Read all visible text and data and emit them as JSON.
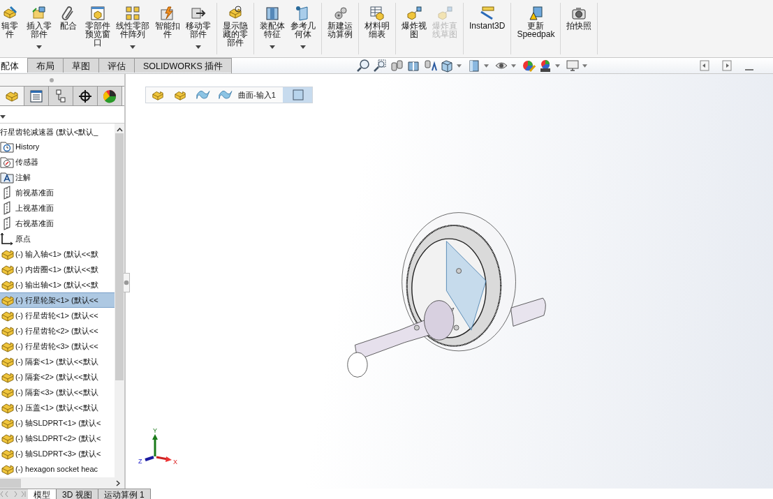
{
  "ribbon": {
    "groups": [
      {
        "buttons": [
          {
            "lines": [
              "辑零",
              "件"
            ],
            "dropdown": false,
            "disabled": false
          },
          {
            "lines": [
              "插入零",
              "部件"
            ],
            "dropdown": true,
            "disabled": false
          },
          {
            "lines": [
              "配合"
            ],
            "dropdown": false,
            "disabled": false
          },
          {
            "lines": [
              "零部件",
              "预览窗",
              "口"
            ],
            "dropdown": false,
            "disabled": false
          },
          {
            "lines": [
              "线性零部",
              "件阵列"
            ],
            "dropdown": true,
            "disabled": false
          },
          {
            "lines": [
              "智能扣",
              "件"
            ],
            "dropdown": false,
            "disabled": false
          },
          {
            "lines": [
              "移动零",
              "部件"
            ],
            "dropdown": true,
            "disabled": false
          }
        ]
      },
      {
        "buttons": [
          {
            "lines": [
              "显示隐",
              "藏的零",
              "部件"
            ],
            "dropdown": false,
            "disabled": false
          }
        ]
      },
      {
        "buttons": [
          {
            "lines": [
              "装配体",
              "特征"
            ],
            "dropdown": true,
            "disabled": false
          },
          {
            "lines": [
              "参考几",
              "何体"
            ],
            "dropdown": true,
            "disabled": false
          }
        ]
      },
      {
        "buttons": [
          {
            "lines": [
              "新建运",
              "动算例"
            ],
            "dropdown": false,
            "disabled": false
          }
        ]
      },
      {
        "buttons": [
          {
            "lines": [
              "材料明",
              "细表"
            ],
            "dropdown": false,
            "disabled": false
          }
        ]
      },
      {
        "buttons": [
          {
            "lines": [
              "爆炸视",
              "图"
            ],
            "dropdown": false,
            "disabled": false
          },
          {
            "lines": [
              "爆炸直",
              "线草图"
            ],
            "dropdown": false,
            "disabled": true
          }
        ]
      },
      {
        "buttons": [
          {
            "lines": [
              "Instant3D"
            ],
            "dropdown": false,
            "disabled": false
          }
        ]
      },
      {
        "buttons": [
          {
            "lines": [
              "更新",
              "Speedpak"
            ],
            "dropdown": false,
            "disabled": false
          }
        ]
      },
      {
        "buttons": [
          {
            "lines": [
              "拍快照"
            ],
            "dropdown": false,
            "disabled": false
          }
        ]
      }
    ]
  },
  "command_tabs": [
    {
      "label": "配体",
      "selected": true
    },
    {
      "label": "布局",
      "selected": false
    },
    {
      "label": "草图",
      "selected": false
    },
    {
      "label": "评估",
      "selected": false
    },
    {
      "label": "SOLIDWORKS 插件",
      "selected": false
    }
  ],
  "feature_tree": {
    "root": {
      "label": "行星齿轮减速器  (默认<默认_",
      "children": [
        {
          "kind": "history",
          "label": "History",
          "selected": false
        },
        {
          "kind": "sensor",
          "label": "传感器",
          "selected": false
        },
        {
          "kind": "annotation",
          "label": "注解",
          "selected": false
        },
        {
          "kind": "plane",
          "label": "前视基准面",
          "selected": false
        },
        {
          "kind": "plane",
          "label": "上视基准面",
          "selected": false
        },
        {
          "kind": "plane",
          "label": "右视基准面",
          "selected": false
        },
        {
          "kind": "origin",
          "label": "原点",
          "selected": false
        },
        {
          "kind": "part",
          "label": "(-) 输入轴<1> (默认<<默",
          "selected": false
        },
        {
          "kind": "part",
          "label": "(-) 内齿圈<1> (默认<<默",
          "selected": false
        },
        {
          "kind": "part",
          "label": "(-) 输出轴<1> (默认<<默",
          "selected": false
        },
        {
          "kind": "part",
          "label": "(-) 行星轮架<1> (默认<<",
          "selected": true
        },
        {
          "kind": "part",
          "label": "(-) 行星齿轮<1> (默认<<",
          "selected": false
        },
        {
          "kind": "part",
          "label": "(-) 行星齿轮<2> (默认<<",
          "selected": false
        },
        {
          "kind": "part",
          "label": "(-) 行星齿轮<3> (默认<<",
          "selected": false
        },
        {
          "kind": "part",
          "label": "(-) 隔套<1> (默认<<默认",
          "selected": false
        },
        {
          "kind": "part",
          "label": "(-) 隔套<2> (默认<<默认",
          "selected": false
        },
        {
          "kind": "part",
          "label": "(-) 隔套<3> (默认<<默认",
          "selected": false
        },
        {
          "kind": "part",
          "label": "(-) 压盖<1> (默认<<默认",
          "selected": false
        },
        {
          "kind": "part",
          "label": "(-) 轴SLDPRT<1> (默认<",
          "selected": false
        },
        {
          "kind": "part",
          "label": "(-) 轴SLDPRT<2> (默认<",
          "selected": false
        },
        {
          "kind": "part",
          "label": "(-) 轴SLDPRT<3> (默认<",
          "selected": false
        },
        {
          "kind": "part",
          "label": "(-) hexagon socket heac",
          "selected": false
        }
      ]
    }
  },
  "pane_tabs": [
    {
      "kind": "features",
      "selected": true
    },
    {
      "kind": "properties",
      "selected": false
    },
    {
      "kind": "config",
      "selected": false
    },
    {
      "kind": "dimxpert",
      "selected": false
    },
    {
      "kind": "display",
      "selected": false
    }
  ],
  "bottom_tabs": [
    {
      "label": "模型",
      "selected": true
    },
    {
      "label": "3D 视图",
      "selected": false
    },
    {
      "label": "运动算例 1",
      "selected": false
    }
  ],
  "breadcrumb": {
    "label": "曲面-输入1"
  },
  "triad": {
    "x": "X",
    "y": "Y",
    "z": "Z"
  }
}
